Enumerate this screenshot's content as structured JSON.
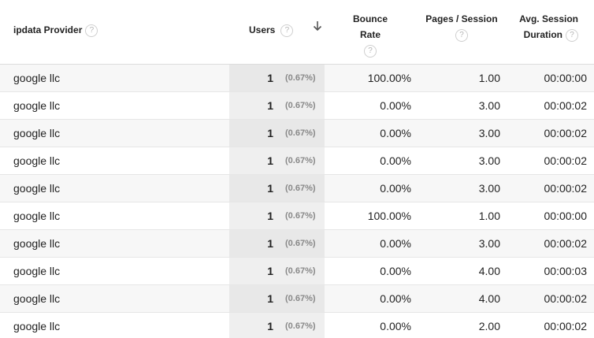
{
  "header": {
    "provider": "ipdata Provider",
    "users": "Users",
    "bounce_rate": "Bounce Rate",
    "pages_session": "Pages / Session",
    "duration_line1": "Avg. Session",
    "duration_line2": "Duration",
    "help_glyph": "?"
  },
  "rows": [
    {
      "provider": "google llc",
      "users": "1",
      "users_pct": "(0.67%)",
      "bounce_rate": "100.00%",
      "pages_session": "1.00",
      "duration": "00:00:00"
    },
    {
      "provider": "google llc",
      "users": "1",
      "users_pct": "(0.67%)",
      "bounce_rate": "0.00%",
      "pages_session": "3.00",
      "duration": "00:00:02"
    },
    {
      "provider": "google llc",
      "users": "1",
      "users_pct": "(0.67%)",
      "bounce_rate": "0.00%",
      "pages_session": "3.00",
      "duration": "00:00:02"
    },
    {
      "provider": "google llc",
      "users": "1",
      "users_pct": "(0.67%)",
      "bounce_rate": "0.00%",
      "pages_session": "3.00",
      "duration": "00:00:02"
    },
    {
      "provider": "google llc",
      "users": "1",
      "users_pct": "(0.67%)",
      "bounce_rate": "0.00%",
      "pages_session": "3.00",
      "duration": "00:00:02"
    },
    {
      "provider": "google llc",
      "users": "1",
      "users_pct": "(0.67%)",
      "bounce_rate": "100.00%",
      "pages_session": "1.00",
      "duration": "00:00:00"
    },
    {
      "provider": "google llc",
      "users": "1",
      "users_pct": "(0.67%)",
      "bounce_rate": "0.00%",
      "pages_session": "3.00",
      "duration": "00:00:02"
    },
    {
      "provider": "google llc",
      "users": "1",
      "users_pct": "(0.67%)",
      "bounce_rate": "0.00%",
      "pages_session": "4.00",
      "duration": "00:00:03"
    },
    {
      "provider": "google llc",
      "users": "1",
      "users_pct": "(0.67%)",
      "bounce_rate": "0.00%",
      "pages_session": "4.00",
      "duration": "00:00:02"
    },
    {
      "provider": "google llc",
      "users": "1",
      "users_pct": "(0.67%)",
      "bounce_rate": "0.00%",
      "pages_session": "2.00",
      "duration": "00:00:02"
    }
  ]
}
